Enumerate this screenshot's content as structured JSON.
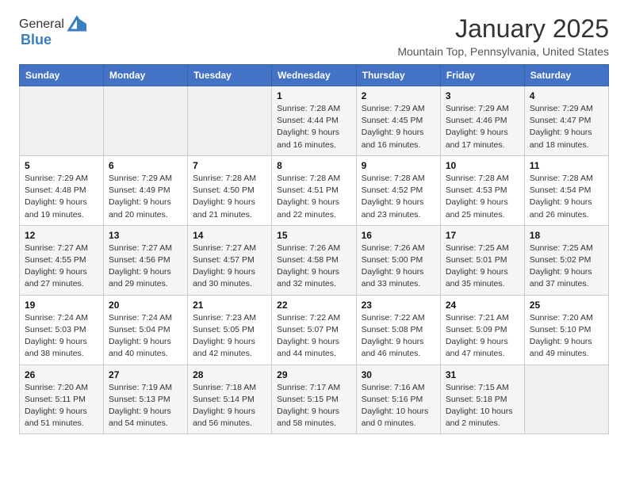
{
  "header": {
    "logo_general": "General",
    "logo_blue": "Blue",
    "month": "January 2025",
    "location": "Mountain Top, Pennsylvania, United States"
  },
  "days_of_week": [
    "Sunday",
    "Monday",
    "Tuesday",
    "Wednesday",
    "Thursday",
    "Friday",
    "Saturday"
  ],
  "weeks": [
    [
      {
        "day": "",
        "info": ""
      },
      {
        "day": "",
        "info": ""
      },
      {
        "day": "",
        "info": ""
      },
      {
        "day": "1",
        "info": "Sunrise: 7:28 AM\nSunset: 4:44 PM\nDaylight: 9 hours\nand 16 minutes."
      },
      {
        "day": "2",
        "info": "Sunrise: 7:29 AM\nSunset: 4:45 PM\nDaylight: 9 hours\nand 16 minutes."
      },
      {
        "day": "3",
        "info": "Sunrise: 7:29 AM\nSunset: 4:46 PM\nDaylight: 9 hours\nand 17 minutes."
      },
      {
        "day": "4",
        "info": "Sunrise: 7:29 AM\nSunset: 4:47 PM\nDaylight: 9 hours\nand 18 minutes."
      }
    ],
    [
      {
        "day": "5",
        "info": "Sunrise: 7:29 AM\nSunset: 4:48 PM\nDaylight: 9 hours\nand 19 minutes."
      },
      {
        "day": "6",
        "info": "Sunrise: 7:29 AM\nSunset: 4:49 PM\nDaylight: 9 hours\nand 20 minutes."
      },
      {
        "day": "7",
        "info": "Sunrise: 7:28 AM\nSunset: 4:50 PM\nDaylight: 9 hours\nand 21 minutes."
      },
      {
        "day": "8",
        "info": "Sunrise: 7:28 AM\nSunset: 4:51 PM\nDaylight: 9 hours\nand 22 minutes."
      },
      {
        "day": "9",
        "info": "Sunrise: 7:28 AM\nSunset: 4:52 PM\nDaylight: 9 hours\nand 23 minutes."
      },
      {
        "day": "10",
        "info": "Sunrise: 7:28 AM\nSunset: 4:53 PM\nDaylight: 9 hours\nand 25 minutes."
      },
      {
        "day": "11",
        "info": "Sunrise: 7:28 AM\nSunset: 4:54 PM\nDaylight: 9 hours\nand 26 minutes."
      }
    ],
    [
      {
        "day": "12",
        "info": "Sunrise: 7:27 AM\nSunset: 4:55 PM\nDaylight: 9 hours\nand 27 minutes."
      },
      {
        "day": "13",
        "info": "Sunrise: 7:27 AM\nSunset: 4:56 PM\nDaylight: 9 hours\nand 29 minutes."
      },
      {
        "day": "14",
        "info": "Sunrise: 7:27 AM\nSunset: 4:57 PM\nDaylight: 9 hours\nand 30 minutes."
      },
      {
        "day": "15",
        "info": "Sunrise: 7:26 AM\nSunset: 4:58 PM\nDaylight: 9 hours\nand 32 minutes."
      },
      {
        "day": "16",
        "info": "Sunrise: 7:26 AM\nSunset: 5:00 PM\nDaylight: 9 hours\nand 33 minutes."
      },
      {
        "day": "17",
        "info": "Sunrise: 7:25 AM\nSunset: 5:01 PM\nDaylight: 9 hours\nand 35 minutes."
      },
      {
        "day": "18",
        "info": "Sunrise: 7:25 AM\nSunset: 5:02 PM\nDaylight: 9 hours\nand 37 minutes."
      }
    ],
    [
      {
        "day": "19",
        "info": "Sunrise: 7:24 AM\nSunset: 5:03 PM\nDaylight: 9 hours\nand 38 minutes."
      },
      {
        "day": "20",
        "info": "Sunrise: 7:24 AM\nSunset: 5:04 PM\nDaylight: 9 hours\nand 40 minutes."
      },
      {
        "day": "21",
        "info": "Sunrise: 7:23 AM\nSunset: 5:05 PM\nDaylight: 9 hours\nand 42 minutes."
      },
      {
        "day": "22",
        "info": "Sunrise: 7:22 AM\nSunset: 5:07 PM\nDaylight: 9 hours\nand 44 minutes."
      },
      {
        "day": "23",
        "info": "Sunrise: 7:22 AM\nSunset: 5:08 PM\nDaylight: 9 hours\nand 46 minutes."
      },
      {
        "day": "24",
        "info": "Sunrise: 7:21 AM\nSunset: 5:09 PM\nDaylight: 9 hours\nand 47 minutes."
      },
      {
        "day": "25",
        "info": "Sunrise: 7:20 AM\nSunset: 5:10 PM\nDaylight: 9 hours\nand 49 minutes."
      }
    ],
    [
      {
        "day": "26",
        "info": "Sunrise: 7:20 AM\nSunset: 5:11 PM\nDaylight: 9 hours\nand 51 minutes."
      },
      {
        "day": "27",
        "info": "Sunrise: 7:19 AM\nSunset: 5:13 PM\nDaylight: 9 hours\nand 54 minutes."
      },
      {
        "day": "28",
        "info": "Sunrise: 7:18 AM\nSunset: 5:14 PM\nDaylight: 9 hours\nand 56 minutes."
      },
      {
        "day": "29",
        "info": "Sunrise: 7:17 AM\nSunset: 5:15 PM\nDaylight: 9 hours\nand 58 minutes."
      },
      {
        "day": "30",
        "info": "Sunrise: 7:16 AM\nSunset: 5:16 PM\nDaylight: 10 hours\nand 0 minutes."
      },
      {
        "day": "31",
        "info": "Sunrise: 7:15 AM\nSunset: 5:18 PM\nDaylight: 10 hours\nand 2 minutes."
      },
      {
        "day": "",
        "info": ""
      }
    ]
  ]
}
